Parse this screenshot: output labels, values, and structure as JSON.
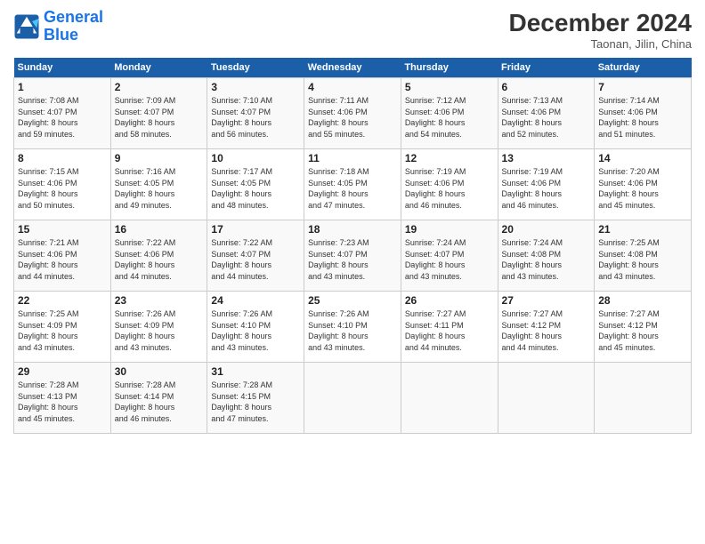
{
  "header": {
    "logo_line1": "General",
    "logo_line2": "Blue",
    "month": "December 2024",
    "location": "Taonan, Jilin, China"
  },
  "days_of_week": [
    "Sunday",
    "Monday",
    "Tuesday",
    "Wednesday",
    "Thursday",
    "Friday",
    "Saturday"
  ],
  "weeks": [
    [
      {
        "day": "1",
        "info": "Sunrise: 7:08 AM\nSunset: 4:07 PM\nDaylight: 8 hours\nand 59 minutes."
      },
      {
        "day": "2",
        "info": "Sunrise: 7:09 AM\nSunset: 4:07 PM\nDaylight: 8 hours\nand 58 minutes."
      },
      {
        "day": "3",
        "info": "Sunrise: 7:10 AM\nSunset: 4:07 PM\nDaylight: 8 hours\nand 56 minutes."
      },
      {
        "day": "4",
        "info": "Sunrise: 7:11 AM\nSunset: 4:06 PM\nDaylight: 8 hours\nand 55 minutes."
      },
      {
        "day": "5",
        "info": "Sunrise: 7:12 AM\nSunset: 4:06 PM\nDaylight: 8 hours\nand 54 minutes."
      },
      {
        "day": "6",
        "info": "Sunrise: 7:13 AM\nSunset: 4:06 PM\nDaylight: 8 hours\nand 52 minutes."
      },
      {
        "day": "7",
        "info": "Sunrise: 7:14 AM\nSunset: 4:06 PM\nDaylight: 8 hours\nand 51 minutes."
      }
    ],
    [
      {
        "day": "8",
        "info": "Sunrise: 7:15 AM\nSunset: 4:06 PM\nDaylight: 8 hours\nand 50 minutes."
      },
      {
        "day": "9",
        "info": "Sunrise: 7:16 AM\nSunset: 4:05 PM\nDaylight: 8 hours\nand 49 minutes."
      },
      {
        "day": "10",
        "info": "Sunrise: 7:17 AM\nSunset: 4:05 PM\nDaylight: 8 hours\nand 48 minutes."
      },
      {
        "day": "11",
        "info": "Sunrise: 7:18 AM\nSunset: 4:05 PM\nDaylight: 8 hours\nand 47 minutes."
      },
      {
        "day": "12",
        "info": "Sunrise: 7:19 AM\nSunset: 4:06 PM\nDaylight: 8 hours\nand 46 minutes."
      },
      {
        "day": "13",
        "info": "Sunrise: 7:19 AM\nSunset: 4:06 PM\nDaylight: 8 hours\nand 46 minutes."
      },
      {
        "day": "14",
        "info": "Sunrise: 7:20 AM\nSunset: 4:06 PM\nDaylight: 8 hours\nand 45 minutes."
      }
    ],
    [
      {
        "day": "15",
        "info": "Sunrise: 7:21 AM\nSunset: 4:06 PM\nDaylight: 8 hours\nand 44 minutes."
      },
      {
        "day": "16",
        "info": "Sunrise: 7:22 AM\nSunset: 4:06 PM\nDaylight: 8 hours\nand 44 minutes."
      },
      {
        "day": "17",
        "info": "Sunrise: 7:22 AM\nSunset: 4:07 PM\nDaylight: 8 hours\nand 44 minutes."
      },
      {
        "day": "18",
        "info": "Sunrise: 7:23 AM\nSunset: 4:07 PM\nDaylight: 8 hours\nand 43 minutes."
      },
      {
        "day": "19",
        "info": "Sunrise: 7:24 AM\nSunset: 4:07 PM\nDaylight: 8 hours\nand 43 minutes."
      },
      {
        "day": "20",
        "info": "Sunrise: 7:24 AM\nSunset: 4:08 PM\nDaylight: 8 hours\nand 43 minutes."
      },
      {
        "day": "21",
        "info": "Sunrise: 7:25 AM\nSunset: 4:08 PM\nDaylight: 8 hours\nand 43 minutes."
      }
    ],
    [
      {
        "day": "22",
        "info": "Sunrise: 7:25 AM\nSunset: 4:09 PM\nDaylight: 8 hours\nand 43 minutes."
      },
      {
        "day": "23",
        "info": "Sunrise: 7:26 AM\nSunset: 4:09 PM\nDaylight: 8 hours\nand 43 minutes."
      },
      {
        "day": "24",
        "info": "Sunrise: 7:26 AM\nSunset: 4:10 PM\nDaylight: 8 hours\nand 43 minutes."
      },
      {
        "day": "25",
        "info": "Sunrise: 7:26 AM\nSunset: 4:10 PM\nDaylight: 8 hours\nand 43 minutes."
      },
      {
        "day": "26",
        "info": "Sunrise: 7:27 AM\nSunset: 4:11 PM\nDaylight: 8 hours\nand 44 minutes."
      },
      {
        "day": "27",
        "info": "Sunrise: 7:27 AM\nSunset: 4:12 PM\nDaylight: 8 hours\nand 44 minutes."
      },
      {
        "day": "28",
        "info": "Sunrise: 7:27 AM\nSunset: 4:12 PM\nDaylight: 8 hours\nand 45 minutes."
      }
    ],
    [
      {
        "day": "29",
        "info": "Sunrise: 7:28 AM\nSunset: 4:13 PM\nDaylight: 8 hours\nand 45 minutes."
      },
      {
        "day": "30",
        "info": "Sunrise: 7:28 AM\nSunset: 4:14 PM\nDaylight: 8 hours\nand 46 minutes."
      },
      {
        "day": "31",
        "info": "Sunrise: 7:28 AM\nSunset: 4:15 PM\nDaylight: 8 hours\nand 47 minutes."
      },
      {
        "day": "",
        "info": ""
      },
      {
        "day": "",
        "info": ""
      },
      {
        "day": "",
        "info": ""
      },
      {
        "day": "",
        "info": ""
      }
    ]
  ]
}
